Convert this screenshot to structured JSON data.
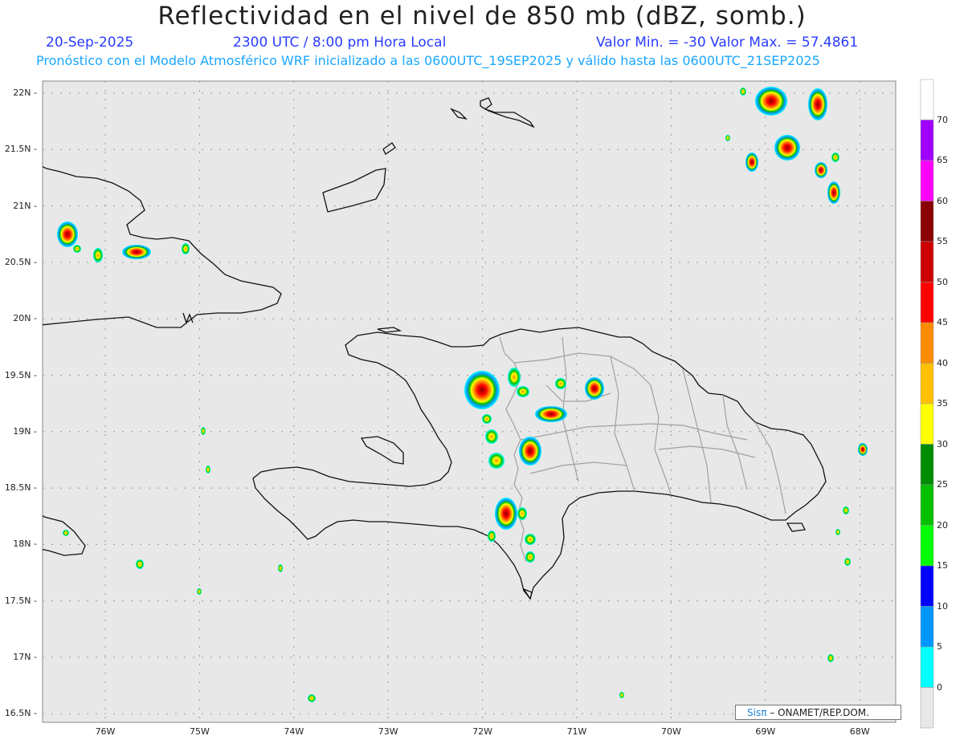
{
  "header": {
    "title": "Reflectividad en el nivel de 850 mb (dBZ, somb.)",
    "date": "20-Sep-2025",
    "time": "2300 UTC / 8:00 pm Hora Local",
    "minmax": "Valor Min. = -30  Valor Max. = 57.4861",
    "forecast": "Pronóstico con el Modelo Atmosférico WRF inicializado a las 0600UTC_19SEP2025 y válido hasta las  0600UTC_21SEP2025"
  },
  "axes": {
    "lat_labels": [
      "22N",
      "21.5N",
      "21N",
      "20.5N",
      "20N",
      "19.5N",
      "19N",
      "18.5N",
      "18N",
      "17.5N",
      "17N",
      "16.5N"
    ],
    "lon_labels": [
      "76W",
      "75W",
      "74W",
      "73W",
      "72W",
      "71W",
      "70W",
      "69W",
      "68W"
    ]
  },
  "colorbar": {
    "labels": [
      "70",
      "65",
      "60",
      "55",
      "50",
      "45",
      "40",
      "35",
      "30",
      "25",
      "20",
      "15",
      "10",
      "5",
      "0"
    ],
    "colors": [
      "#ffffff",
      "#9f00ff",
      "#ff00ff",
      "#8b0000",
      "#cc0000",
      "#ff0000",
      "#ff8c00",
      "#ffc000",
      "#ffff00",
      "#008c00",
      "#00c000",
      "#00ff00",
      "#0000ff",
      "#0096ff",
      "#00ffff",
      "#e8e8e8"
    ]
  },
  "credit": {
    "sis": "Sis",
    "pi": "π",
    "rest": " – ONAMET/REP.DOM."
  },
  "colors": {
    "background": "#e8e8e8",
    "grid": "#999999",
    "coast": "#111111",
    "borders": "#a0a0a0"
  }
}
